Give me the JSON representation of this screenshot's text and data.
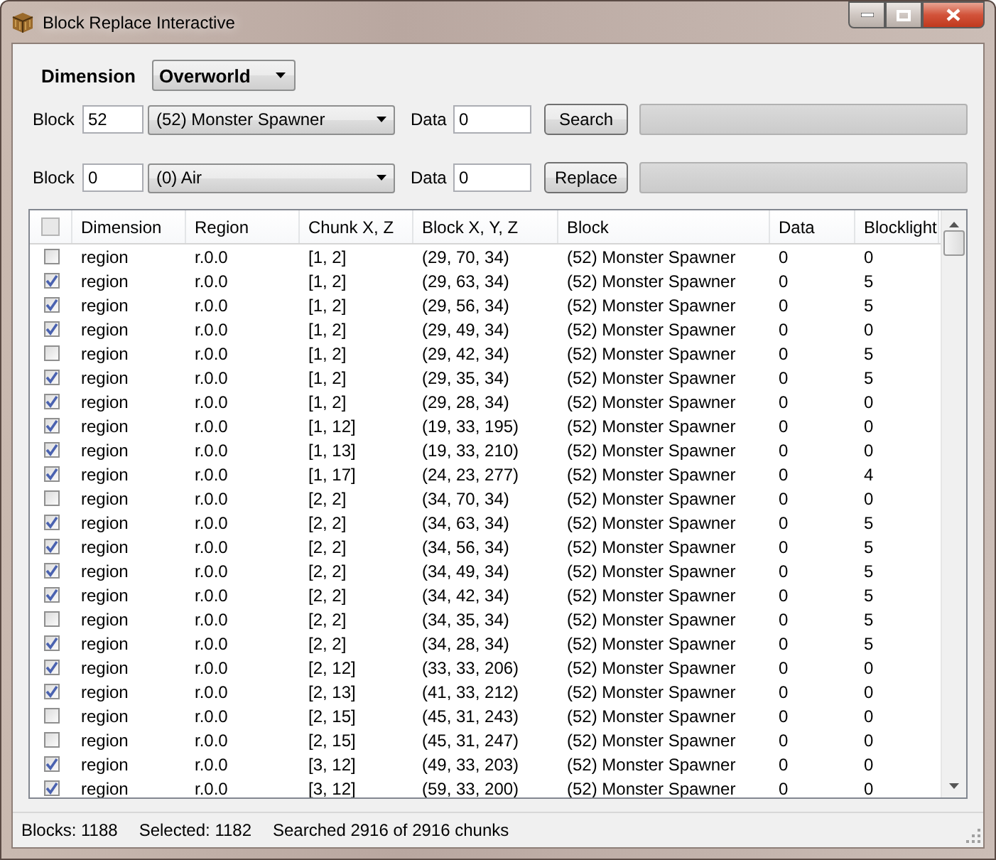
{
  "window": {
    "title": "Block Replace Interactive"
  },
  "dimension": {
    "label": "Dimension",
    "value": "Overworld"
  },
  "search_row": {
    "label": "Block",
    "block_id": "52",
    "block_name": "(52) Monster Spawner",
    "data_label": "Data",
    "data": "0",
    "button": "Search",
    "level": 0
  },
  "replace_row": {
    "label": "Block",
    "block_id": "0",
    "block_name": "(0) Air",
    "data_label": "Data",
    "data": "0",
    "button": "Replace",
    "level": 0
  },
  "table": {
    "select_all_checked": false,
    "columns": [
      "Dimension",
      "Region",
      "Chunk X, Z",
      "Block X, Y, Z",
      "Block",
      "Data",
      "Blocklight"
    ],
    "rows": [
      {
        "checked": false,
        "cells": [
          "region",
          "r.0.0",
          "[1, 2]",
          "(29, 70, 34)",
          "(52) Monster Spawner",
          "0",
          "0"
        ]
      },
      {
        "checked": true,
        "cells": [
          "region",
          "r.0.0",
          "[1, 2]",
          "(29, 63, 34)",
          "(52) Monster Spawner",
          "0",
          "5"
        ]
      },
      {
        "checked": true,
        "cells": [
          "region",
          "r.0.0",
          "[1, 2]",
          "(29, 56, 34)",
          "(52) Monster Spawner",
          "0",
          "5"
        ]
      },
      {
        "checked": true,
        "cells": [
          "region",
          "r.0.0",
          "[1, 2]",
          "(29, 49, 34)",
          "(52) Monster Spawner",
          "0",
          "0"
        ]
      },
      {
        "checked": false,
        "cells": [
          "region",
          "r.0.0",
          "[1, 2]",
          "(29, 42, 34)",
          "(52) Monster Spawner",
          "0",
          "5"
        ]
      },
      {
        "checked": true,
        "cells": [
          "region",
          "r.0.0",
          "[1, 2]",
          "(29, 35, 34)",
          "(52) Monster Spawner",
          "0",
          "5"
        ]
      },
      {
        "checked": true,
        "cells": [
          "region",
          "r.0.0",
          "[1, 2]",
          "(29, 28, 34)",
          "(52) Monster Spawner",
          "0",
          "0"
        ]
      },
      {
        "checked": true,
        "cells": [
          "region",
          "r.0.0",
          "[1, 12]",
          "(19, 33, 195)",
          "(52) Monster Spawner",
          "0",
          "0"
        ]
      },
      {
        "checked": true,
        "cells": [
          "region",
          "r.0.0",
          "[1, 13]",
          "(19, 33, 210)",
          "(52) Monster Spawner",
          "0",
          "0"
        ]
      },
      {
        "checked": true,
        "cells": [
          "region",
          "r.0.0",
          "[1, 17]",
          "(24, 23, 277)",
          "(52) Monster Spawner",
          "0",
          "4"
        ]
      },
      {
        "checked": false,
        "cells": [
          "region",
          "r.0.0",
          "[2, 2]",
          "(34, 70, 34)",
          "(52) Monster Spawner",
          "0",
          "0"
        ]
      },
      {
        "checked": true,
        "cells": [
          "region",
          "r.0.0",
          "[2, 2]",
          "(34, 63, 34)",
          "(52) Monster Spawner",
          "0",
          "5"
        ]
      },
      {
        "checked": true,
        "cells": [
          "region",
          "r.0.0",
          "[2, 2]",
          "(34, 56, 34)",
          "(52) Monster Spawner",
          "0",
          "5"
        ]
      },
      {
        "checked": true,
        "cells": [
          "region",
          "r.0.0",
          "[2, 2]",
          "(34, 49, 34)",
          "(52) Monster Spawner",
          "0",
          "5"
        ]
      },
      {
        "checked": true,
        "cells": [
          "region",
          "r.0.0",
          "[2, 2]",
          "(34, 42, 34)",
          "(52) Monster Spawner",
          "0",
          "5"
        ]
      },
      {
        "checked": false,
        "cells": [
          "region",
          "r.0.0",
          "[2, 2]",
          "(34, 35, 34)",
          "(52) Monster Spawner",
          "0",
          "5"
        ]
      },
      {
        "checked": true,
        "cells": [
          "region",
          "r.0.0",
          "[2, 2]",
          "(34, 28, 34)",
          "(52) Monster Spawner",
          "0",
          "5"
        ]
      },
      {
        "checked": true,
        "cells": [
          "region",
          "r.0.0",
          "[2, 12]",
          "(33, 33, 206)",
          "(52) Monster Spawner",
          "0",
          "0"
        ]
      },
      {
        "checked": true,
        "cells": [
          "region",
          "r.0.0",
          "[2, 13]",
          "(41, 33, 212)",
          "(52) Monster Spawner",
          "0",
          "0"
        ]
      },
      {
        "checked": false,
        "cells": [
          "region",
          "r.0.0",
          "[2, 15]",
          "(45, 31, 243)",
          "(52) Monster Spawner",
          "0",
          "0"
        ]
      },
      {
        "checked": false,
        "cells": [
          "region",
          "r.0.0",
          "[2, 15]",
          "(45, 31, 247)",
          "(52) Monster Spawner",
          "0",
          "0"
        ]
      },
      {
        "checked": true,
        "cells": [
          "region",
          "r.0.0",
          "[3, 12]",
          "(49, 33, 203)",
          "(52) Monster Spawner",
          "0",
          "0"
        ]
      },
      {
        "checked": true,
        "cells": [
          "region",
          "r.0.0",
          "[3, 12]",
          "(59, 33, 200)",
          "(52) Monster Spawner",
          "0",
          "0"
        ]
      }
    ]
  },
  "status_bar": [
    "Blocks: 1188",
    "Selected: 1182",
    "Searched 2916 of 2916 chunks"
  ]
}
